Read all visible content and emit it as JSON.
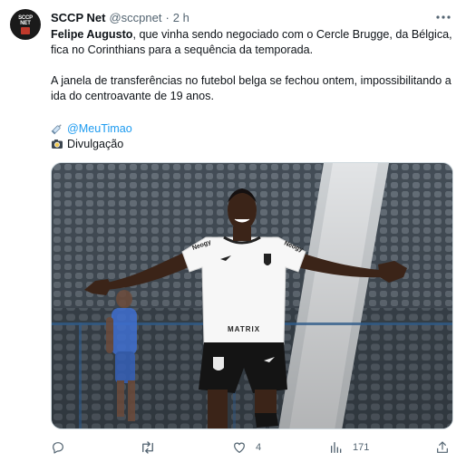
{
  "tweet": {
    "author_name": "SCCP Net",
    "author_handle": "@sccpnet",
    "separator": "·",
    "time": "2 h",
    "avatar_text": "SCCP NET",
    "text_bold": "Felipe Augusto",
    "text_line1": ", que vinha sendo negociado com o Cercle Brugge, da Bélgica, fica no Corinthians para a sequência da temporada.",
    "text_para2": "A janela de transferências no futebol belga se fechou ontem, impossibilitando a ida do centroavante de 19 anos.",
    "link_text": "@MeuTimao",
    "credit_text": "Divulgação",
    "photo": {
      "shirt_sponsor": "MATRIX",
      "sleeve_left": "Neogy",
      "sleeve_right": "Neogy"
    }
  },
  "actions": {
    "reply_count": "",
    "retweet_count": "",
    "like_count": "4",
    "views_count": "171"
  },
  "icons": {
    "more": "more-horizontal-icon",
    "reply": "reply-icon",
    "retweet": "retweet-icon",
    "like": "heart-icon",
    "views": "views-icon",
    "share": "share-icon"
  },
  "colors": {
    "link": "#1d9bf0",
    "secondary_text": "#536471",
    "primary_text": "#0f1419"
  }
}
